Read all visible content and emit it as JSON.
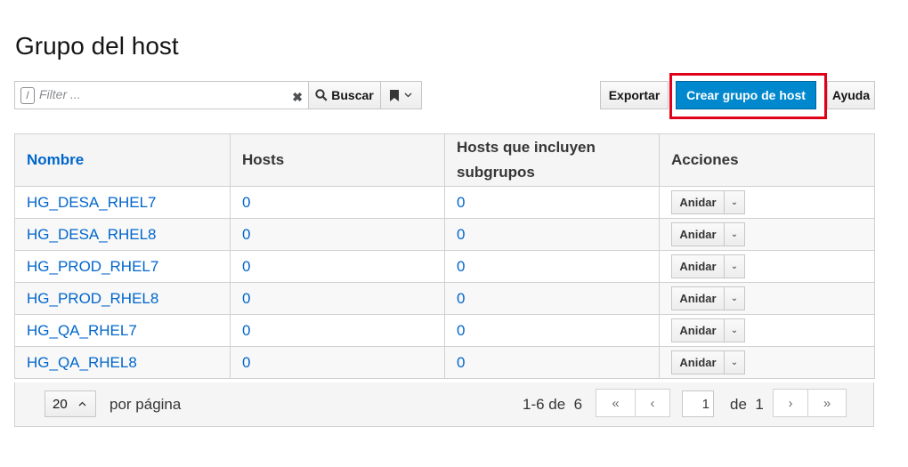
{
  "page": {
    "title": "Grupo del host"
  },
  "search": {
    "slash": "/",
    "placeholder": "Filter ...",
    "clear": "✖",
    "search_label": "Buscar"
  },
  "toolbar": {
    "export_label": "Exportar",
    "create_label": "Crear grupo de host",
    "help_label": "Ayuda"
  },
  "table": {
    "headers": {
      "name": "Nombre",
      "hosts": "Hosts",
      "hosts_sub_1": "Hosts que incluyen",
      "hosts_sub_2": "subgrupos",
      "actions": "Acciones"
    },
    "rows": [
      {
        "name": "HG_DESA_RHEL7",
        "hosts": "0",
        "hosts_sub": "0",
        "action": "Anidar"
      },
      {
        "name": "HG_DESA_RHEL8",
        "hosts": "0",
        "hosts_sub": "0",
        "action": "Anidar"
      },
      {
        "name": "HG_PROD_RHEL7",
        "hosts": "0",
        "hosts_sub": "0",
        "action": "Anidar"
      },
      {
        "name": "HG_PROD_RHEL8",
        "hosts": "0",
        "hosts_sub": "0",
        "action": "Anidar"
      },
      {
        "name": "HG_QA_RHEL7",
        "hosts": "0",
        "hosts_sub": "0",
        "action": "Anidar"
      },
      {
        "name": "HG_QA_RHEL8",
        "hosts": "0",
        "hosts_sub": "0",
        "action": "Anidar"
      }
    ]
  },
  "pagination": {
    "per_page_value": "20",
    "per_page_label": "por página",
    "range": "1-6 de  6",
    "first": "«",
    "prev": "‹",
    "page_value": "1",
    "of_label": "de  1",
    "next": "›",
    "last": "»"
  },
  "colors": {
    "primary": "#0088ce",
    "link": "#0066cc",
    "highlight": "#e0001a"
  }
}
